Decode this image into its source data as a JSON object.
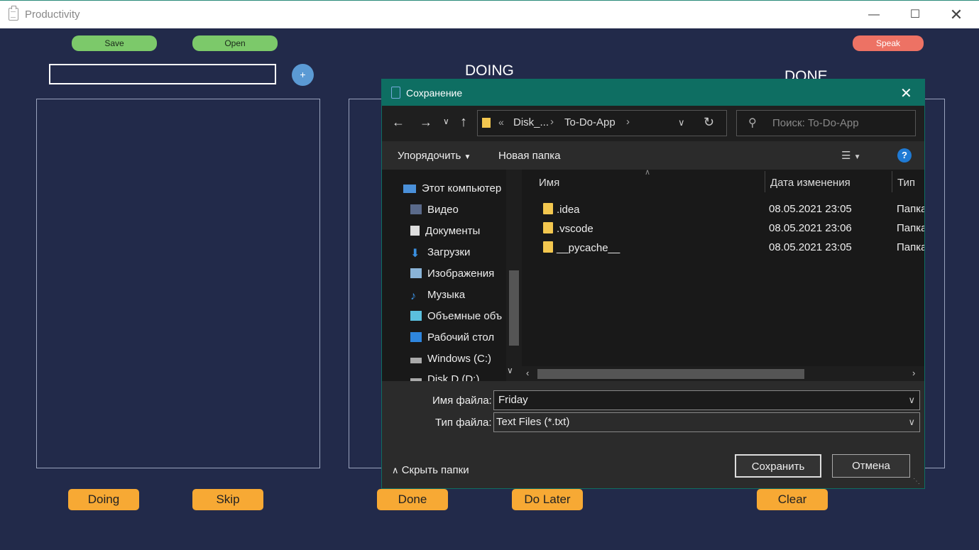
{
  "window": {
    "title": "Productivity"
  },
  "app": {
    "save_label": "Save",
    "open_label": "Open",
    "speak_label": "Speak",
    "add_label": "+",
    "doing_title": "DOING",
    "done_title": "DONE",
    "bottom_buttons": {
      "doing": "Doing",
      "skip": "Skip",
      "done": "Done",
      "do_later": "Do Later",
      "clear": "Clear"
    },
    "colors": {
      "background": "#222a4a",
      "green": "#7cc96a",
      "orange": "#f7a934",
      "speak": "#ed7264",
      "add": "#5b9ad4"
    }
  },
  "dialog": {
    "title": "Сохранение",
    "path_prefix": "«",
    "breadcrumb": [
      "Disk_...",
      "To-Do-App"
    ],
    "search_placeholder": "Поиск: To-Do-App",
    "toolbar": {
      "organize": "Упорядочить",
      "new_folder": "Новая папка",
      "help": "?"
    },
    "nav_items": [
      {
        "label": "Этот компьютер",
        "icon": "computer-icon"
      },
      {
        "label": "Видео",
        "icon": "video-icon"
      },
      {
        "label": "Документы",
        "icon": "documents-icon"
      },
      {
        "label": "Загрузки",
        "icon": "downloads-icon"
      },
      {
        "label": "Изображения",
        "icon": "pictures-icon"
      },
      {
        "label": "Музыка",
        "icon": "music-icon"
      },
      {
        "label": "Объемные объ",
        "icon": "3d-objects-icon"
      },
      {
        "label": "Рабочий стол",
        "icon": "desktop-icon"
      },
      {
        "label": "Windows (C:)",
        "icon": "drive-icon"
      },
      {
        "label": "Disk D (D:)",
        "icon": "drive-icon"
      }
    ],
    "columns": {
      "name": "Имя",
      "modified": "Дата изменения",
      "type": "Тип"
    },
    "files": [
      {
        "name": ".idea",
        "modified": "08.05.2021 23:05",
        "type": "Папка"
      },
      {
        "name": ".vscode",
        "modified": "08.05.2021 23:06",
        "type": "Папка"
      },
      {
        "name": "__pycache__",
        "modified": "08.05.2021 23:05",
        "type": "Папка"
      }
    ],
    "filename_label": "Имя файла:",
    "filename_value": "Friday",
    "filetype_label": "Тип файла:",
    "filetype_value": "Text Files (*.txt)",
    "hide_folders": "Скрыть папки",
    "save_button": "Сохранить",
    "cancel_button": "Отмена"
  }
}
